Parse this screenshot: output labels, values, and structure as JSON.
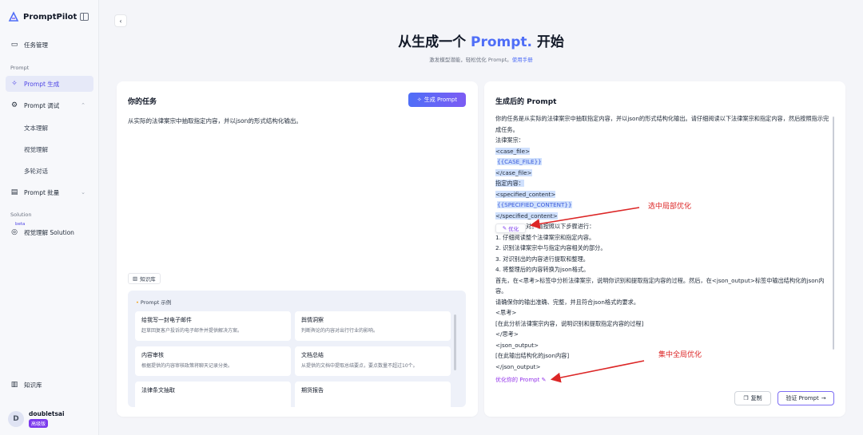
{
  "sidebar": {
    "brand": "PromptPilot",
    "items": {
      "task_mgmt": "任务管理",
      "section_prompt": "Prompt",
      "prompt_gen": "Prompt 生成",
      "prompt_debug": "Prompt 调试",
      "text_understanding": "文本理解",
      "visual_understanding": "视觉理解",
      "multi_turn": "多轮对话",
      "prompt_batch": "Prompt 批量",
      "section_solution": "Solution",
      "beta": "beta",
      "visual_solution": "视觉理解 Solution",
      "knowledge_base": "知识库"
    },
    "user": {
      "initial": "D",
      "name": "doubletsai",
      "badge": "高级版"
    }
  },
  "header": {
    "title_prefix": "从生成一个",
    "title_accent": "Prompt.",
    "title_suffix": "开始",
    "subtitle": "激发模型潜能，轻松优化 Prompt。",
    "manual_link": "使用手册"
  },
  "left_card": {
    "title": "你的任务",
    "generate_button": "生成 Prompt",
    "task_text": "从实际的法律案宗中抽取指定内容，并以json的形式结构化输出。",
    "kb_tag": "知识库",
    "examples_header": "Prompt 示例",
    "examples": [
      {
        "title": "给我写一封电子邮件",
        "desc": "赶草回复客户投诉的电子邮件并提供解决方案。"
      },
      {
        "title": "舆情洞察",
        "desc": "判断舆论的内容对出行行业的影响。"
      },
      {
        "title": "内容审核",
        "desc": "根据提供的内容审核政策将聊天记录分类。"
      },
      {
        "title": "文档总结",
        "desc": "从提供的文档中提取总结要点，要点数量不超过10个。"
      },
      {
        "title": "法律条文抽取",
        "desc": ""
      },
      {
        "title": "期货报告",
        "desc": ""
      }
    ]
  },
  "right_card": {
    "title": "生成后的 Prompt",
    "lines": {
      "l1": "你的任务是从实际的法律案宗中抽取指定内容，并以json的形式结构化输出。请仔细阅读以下法律案宗和指定内容，然后按照指示完成任务。",
      "l2": "法律案宗：",
      "l3": "<case_file>",
      "l4": "{{CASE_FILE}}",
      "l5": "</case_file>",
      "l6": "指定内容：",
      "l7": "<specified_content>",
      "l8": "{{SPECIFIED_CONTENT}}",
      "l9": "</specified_content>",
      "l10": "对。请按照以下步骤进行：",
      "l11": "1. 仔细阅读整个法律案宗和指定内容。",
      "l12": "2. 识别法律案宗中与指定内容相关的部分。",
      "l13": "3. 对识别出的内容进行提取和整理。",
      "l14": "4. 将整理后的内容转换为json格式。",
      "l15": "首先，在<思考>标签中分析法律案宗，说明你识别和提取指定内容的过程。然后，在<json_output>标签中输出结构化的json内容。",
      "l16": "请确保你的输出准确、完整，并且符合json格式的要求。",
      "l17": "<思考>",
      "l18": "[在此分析法律案宗内容，说明识别和提取指定内容的过程]",
      "l19": "</思考>",
      "l20": "<json_output>",
      "l21": "[在此输出结构化的json内容]",
      "l22": "</json_output>"
    },
    "optimize_popup": "优化",
    "optimize_link": "优化你的 Prompt",
    "copy_button": "复制",
    "verify_button": "验证 Prompt"
  },
  "annotations": {
    "local": "选中局部优化",
    "global": "集中全局优化"
  }
}
